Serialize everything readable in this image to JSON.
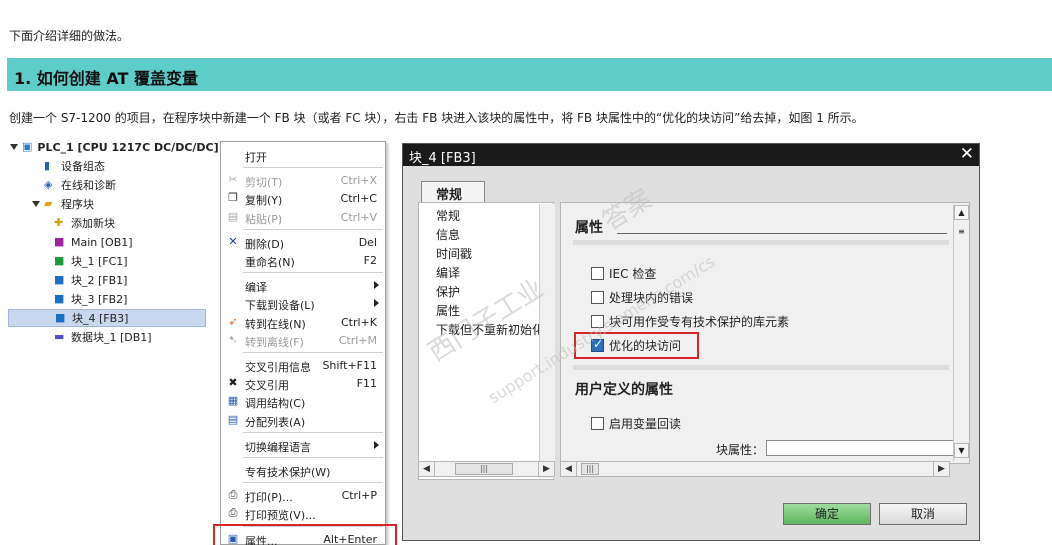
{
  "intro": "下面介绍详细的做法。",
  "heading": "1. 如何创建 AT 覆盖变量",
  "paragraph": "创建一个 S7-1200 的项目，在程序块中新建一个 FB 块（或者 FC 块），右击 FB 块进入该块的属性中，将 FB 块属性中的“优化的块访问”给去掉，如图 1 所示。",
  "tree": [
    {
      "label": "PLC_1 [CPU 1217C DC/DC/DC]",
      "icon": "plc-icon",
      "bold": true,
      "expander": true
    },
    {
      "label": "设备组态",
      "icon": "device-config-icon"
    },
    {
      "label": "在线和诊断",
      "icon": "online-diagnostics-icon"
    },
    {
      "label": "程序块",
      "icon": "folder-icon",
      "expander": true
    },
    {
      "label": "添加新块",
      "icon": "add-block-icon"
    },
    {
      "label": "Main [OB1]",
      "icon": "ob-block-icon"
    },
    {
      "label": "块_1 [FC1]",
      "icon": "fc-block-icon"
    },
    {
      "label": "块_2 [FB1]",
      "icon": "fb-block-icon"
    },
    {
      "label": "块_3 [FB2]",
      "icon": "fb-block-icon"
    },
    {
      "label": "块_4 [FB3]",
      "icon": "fb-block-icon",
      "selected": true
    },
    {
      "label": "数据块_1 [DB1]",
      "icon": "db-block-icon"
    }
  ],
  "menu": [
    {
      "label": "打开",
      "shortcut": "",
      "icon": ""
    },
    {
      "sep": true
    },
    {
      "label": "剪切(T)",
      "shortcut": "Ctrl+X",
      "icon": "cut-icon",
      "disabled": true
    },
    {
      "label": "复制(Y)",
      "shortcut": "Ctrl+C",
      "icon": "copy-icon"
    },
    {
      "label": "粘贴(P)",
      "shortcut": "Ctrl+V",
      "icon": "paste-icon",
      "disabled": true
    },
    {
      "sep": true
    },
    {
      "label": "删除(D)",
      "shortcut": "Del",
      "icon": "delete-icon"
    },
    {
      "label": "重命名(N)",
      "shortcut": "F2",
      "icon": ""
    },
    {
      "sep": true
    },
    {
      "label": "编译",
      "shortcut": "",
      "icon": "",
      "submenu": true
    },
    {
      "label": "下载到设备(L)",
      "shortcut": "",
      "icon": "",
      "submenu": true
    },
    {
      "label": "转到在线(N)",
      "shortcut": "Ctrl+K",
      "icon": "go-online-icon"
    },
    {
      "label": "转到离线(F)",
      "shortcut": "Ctrl+M",
      "icon": "go-offline-icon",
      "disabled": true
    },
    {
      "sep": true
    },
    {
      "label": "交叉引用信息",
      "shortcut": "Shift+F11",
      "icon": ""
    },
    {
      "label": "交叉引用",
      "shortcut": "F11",
      "icon": "cross-reference-icon"
    },
    {
      "label": "调用结构(C)",
      "shortcut": "",
      "icon": "call-structure-icon"
    },
    {
      "label": "分配列表(A)",
      "shortcut": "",
      "icon": "assignment-list-icon"
    },
    {
      "sep": true
    },
    {
      "label": "切换编程语言",
      "shortcut": "",
      "icon": "",
      "submenu": true
    },
    {
      "sep": true
    },
    {
      "label": "专有技术保护(W)",
      "shortcut": "",
      "icon": ""
    },
    {
      "sep": true
    },
    {
      "label": "打印(P)...",
      "shortcut": "Ctrl+P",
      "icon": "print-icon"
    },
    {
      "label": "打印预览(V)...",
      "shortcut": "",
      "icon": "print-preview-icon"
    },
    {
      "sep": true
    },
    {
      "label": "属性...",
      "shortcut": "Alt+Enter",
      "icon": "properties-icon",
      "highlighted": true
    }
  ],
  "dialog": {
    "title": "块_4 [FB3]",
    "tab": "常规",
    "nav": [
      "常规",
      "信息",
      "时间戳",
      "编译",
      "保护",
      "属性",
      "下载但不重新初始化"
    ],
    "section1": "属性",
    "checks": [
      {
        "label": "IEC 检查",
        "checked": false
      },
      {
        "label": "处理块内的错误",
        "checked": false
      },
      {
        "label": "块可用作受专有技术保护的库元素",
        "checked": false
      },
      {
        "label": "优化的块访问",
        "checked": true,
        "highlighted": true
      }
    ],
    "section2": "用户定义的属性",
    "check2": {
      "label": "启用变量回读",
      "checked": false
    },
    "attr_label": "块属性：",
    "ok": "确定",
    "cancel": "取消"
  },
  "watermark": [
    "西门子工业",
    "support.industry.siemens.com/cs",
    "答案"
  ]
}
